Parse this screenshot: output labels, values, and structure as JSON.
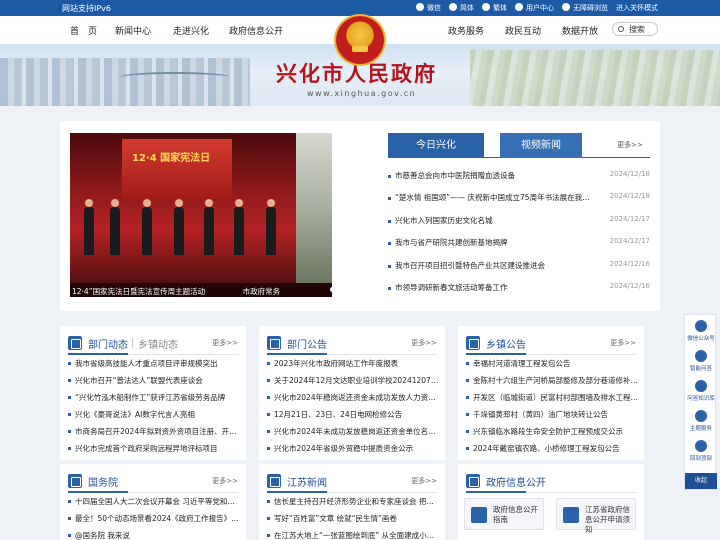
{
  "topbar": {
    "ipv6": "网站支持IPv6",
    "links": [
      "微信",
      "简体",
      "繁体",
      "用户中心",
      "无障碍浏览",
      "进入关怀模式"
    ]
  },
  "nav": {
    "left": [
      "首　页",
      "新闻中心",
      "走进兴化",
      "政府信息公开"
    ],
    "right": [
      "政务服务",
      "政民互动",
      "数据开放"
    ],
    "search": "搜索"
  },
  "banner": {
    "title": "兴化市人民政府",
    "domain": "www.xinghua.gov.cn"
  },
  "carousel": {
    "screen_text": "12·4 国家宪法日",
    "caption": "12·4”国家宪法日暨宪法宣传周主题活动　　　　　市政府常务",
    "slides": 4,
    "active_slide": 1
  },
  "news": {
    "tabs": [
      "今日兴化",
      "视频新闻"
    ],
    "more": "更多>>",
    "items": [
      {
        "title": "市慈善总会向市中医院捐赠血透设备",
        "date": "2024/12/18"
      },
      {
        "title": "“楚水情 祖国颂”—— 庆祝新中国成立75周年书法展在我市...",
        "date": "2024/12/18"
      },
      {
        "title": "兴化市入列国家历史文化名城",
        "date": "2024/12/17"
      },
      {
        "title": "我市与省产研院共建创新基地揭牌",
        "date": "2024/12/17"
      },
      {
        "title": "我市召开项目招引暨特色产业共区建设推进会",
        "date": "2024/12/16"
      },
      {
        "title": "市领导调研新春文旅活动筹备工作",
        "date": "2024/12/16"
      }
    ]
  },
  "panels": {
    "dept": {
      "title": "部门动态",
      "alt": "乡镇动态",
      "more": "更多>>",
      "items": [
        "我市省级高技能人才重点项目评审规模突出",
        "兴化市召开“普法达人”联盟代表座谈会",
        "“兴化竹泓木船制作工”获评江苏省级劳务品牌",
        "兴化《豪哥说法》AI数字代言人亮相",
        "市商务局召开2024年拟到资外资项目注册、开户专...",
        "兴化市完成首个政府采购远程异地评标项目"
      ]
    },
    "notice": {
      "title": "部门公告",
      "more": "更多>>",
      "items": [
        "2023年兴化市政府网站工作年度报表",
        "关于2024年12月文达职业培训学校20241207班次...",
        "兴化市2024年稳岗返还资金未成功发放人力资源服...",
        "12月21日、23日、24日电网检修公告",
        "兴化市2024年未成功发放稳岗返还资金单位名单最...",
        "兴化市2024年省级外贸稳中提质资金公示"
      ]
    },
    "town": {
      "title": "乡镇公告",
      "more": "更多>>",
      "items": [
        "幸福村河道清理工程发包公告",
        "金陈村十六组生产河桥局部整修及部分巷道修补工...",
        "开发区（临城街道）民富村村部围墙及排水工程资...",
        "千垛镇黄邳村（黄四）油厂地块转让公告",
        "兴东镇临水路段生命安全防护工程预成交公示",
        "2024年戴窑镇农路、小桥修理工程发包公告"
      ]
    },
    "council": {
      "title": "国务院",
      "more": "更多>>",
      "items": [
        "十四届全国人大二次会议开幕会 习近平等党和国家...",
        "最全！50个动态场景看2024《政府工作报告》全文",
        "@国务院 我来说"
      ]
    },
    "jiangsu": {
      "title": "江苏新闻",
      "more": "更多>>",
      "items": [
        "信长星主持召开经济形势企业和专家座谈会 把握机...",
        "写好“百姓富”文章 绘就“民生情”画卷",
        "在江苏大地上“一张蓝图绘到底” 从全面建成小康社..."
      ]
    },
    "govinfo": {
      "title": "政府信息公开",
      "buttons": [
        "政府信息公开指南",
        "江苏省政府信息公开申请须知"
      ]
    }
  },
  "floatbar": {
    "items": [
      "微信公众号",
      "智能问答",
      "问答知识库",
      "主题服务",
      "回到顶部"
    ],
    "back": "收起"
  }
}
